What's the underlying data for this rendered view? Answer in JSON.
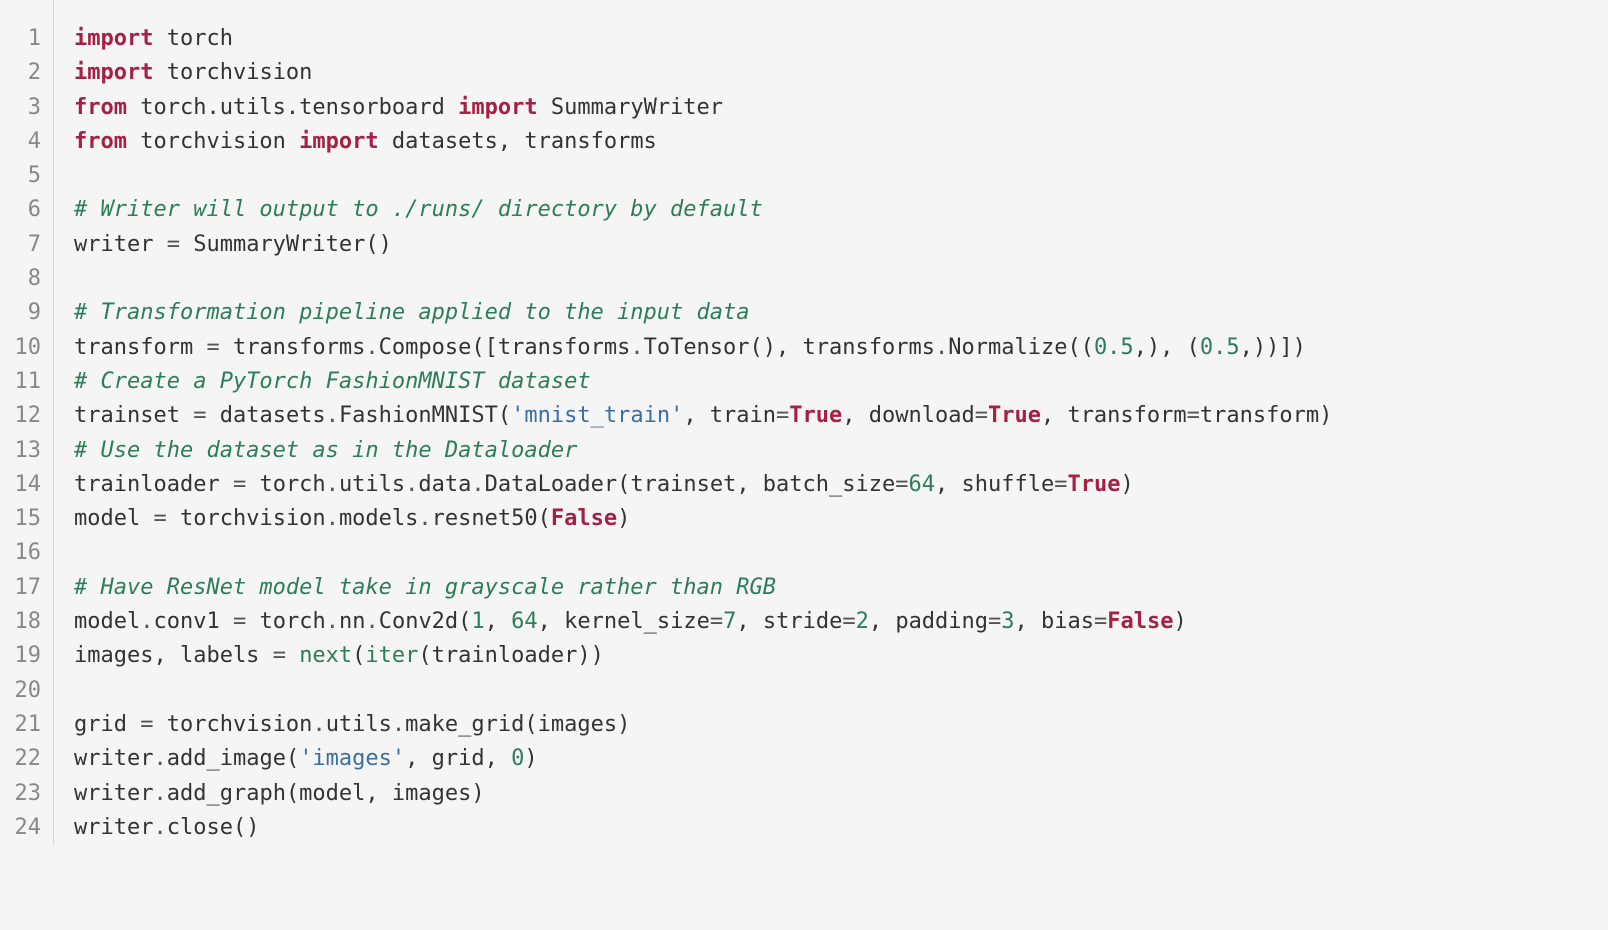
{
  "lines": [
    {
      "n": 1,
      "tokens": [
        {
          "t": "import",
          "c": "kw"
        },
        {
          "t": " torch"
        }
      ]
    },
    {
      "n": 2,
      "tokens": [
        {
          "t": "import",
          "c": "kw"
        },
        {
          "t": " torchvision"
        }
      ]
    },
    {
      "n": 3,
      "tokens": [
        {
          "t": "from",
          "c": "kw"
        },
        {
          "t": " torch.utils.tensorboard "
        },
        {
          "t": "import",
          "c": "kw"
        },
        {
          "t": " SummaryWriter"
        }
      ]
    },
    {
      "n": 4,
      "tokens": [
        {
          "t": "from",
          "c": "kw"
        },
        {
          "t": " torchvision "
        },
        {
          "t": "import",
          "c": "kw"
        },
        {
          "t": " datasets, transforms"
        }
      ]
    },
    {
      "n": 5,
      "tokens": []
    },
    {
      "n": 6,
      "tokens": [
        {
          "t": "# Writer will output to ./runs/ directory by default",
          "c": "cm"
        }
      ]
    },
    {
      "n": 7,
      "tokens": [
        {
          "t": "writer "
        },
        {
          "t": "=",
          "c": "op"
        },
        {
          "t": " SummaryWriter()"
        }
      ]
    },
    {
      "n": 8,
      "tokens": []
    },
    {
      "n": 9,
      "tokens": [
        {
          "t": "# Transformation pipeline applied to the input data",
          "c": "cm"
        }
      ]
    },
    {
      "n": 10,
      "tokens": [
        {
          "t": "transform "
        },
        {
          "t": "=",
          "c": "op"
        },
        {
          "t": " transforms"
        },
        {
          "t": ".",
          "c": "op"
        },
        {
          "t": "Compose([transforms"
        },
        {
          "t": ".",
          "c": "op"
        },
        {
          "t": "ToTensor(), transforms"
        },
        {
          "t": ".",
          "c": "op"
        },
        {
          "t": "Normalize(("
        },
        {
          "t": "0.5",
          "c": "nm"
        },
        {
          "t": ",), ("
        },
        {
          "t": "0.5",
          "c": "nm"
        },
        {
          "t": ",))])"
        }
      ]
    },
    {
      "n": 11,
      "tokens": [
        {
          "t": "# Create a PyTorch FashionMNIST dataset",
          "c": "cm"
        }
      ]
    },
    {
      "n": 12,
      "tokens": [
        {
          "t": "trainset "
        },
        {
          "t": "=",
          "c": "op"
        },
        {
          "t": " datasets"
        },
        {
          "t": ".",
          "c": "op"
        },
        {
          "t": "FashionMNIST("
        },
        {
          "t": "'mnist_train'",
          "c": "st"
        },
        {
          "t": ", train"
        },
        {
          "t": "=",
          "c": "op"
        },
        {
          "t": "True",
          "c": "bool"
        },
        {
          "t": ", download"
        },
        {
          "t": "=",
          "c": "op"
        },
        {
          "t": "True",
          "c": "bool"
        },
        {
          "t": ", transform"
        },
        {
          "t": "=",
          "c": "op"
        },
        {
          "t": "transform)"
        }
      ]
    },
    {
      "n": 13,
      "tokens": [
        {
          "t": "# Use the dataset as in the Dataloader",
          "c": "cm"
        }
      ]
    },
    {
      "n": 14,
      "tokens": [
        {
          "t": "trainloader "
        },
        {
          "t": "=",
          "c": "op"
        },
        {
          "t": " torch"
        },
        {
          "t": ".",
          "c": "op"
        },
        {
          "t": "utils"
        },
        {
          "t": ".",
          "c": "op"
        },
        {
          "t": "data"
        },
        {
          "t": ".",
          "c": "op"
        },
        {
          "t": "DataLoader(trainset, batch_size"
        },
        {
          "t": "=",
          "c": "op"
        },
        {
          "t": "64",
          "c": "nm"
        },
        {
          "t": ", shuffle"
        },
        {
          "t": "=",
          "c": "op"
        },
        {
          "t": "True",
          "c": "bool"
        },
        {
          "t": ")"
        }
      ]
    },
    {
      "n": 15,
      "tokens": [
        {
          "t": "model "
        },
        {
          "t": "=",
          "c": "op"
        },
        {
          "t": " torchvision"
        },
        {
          "t": ".",
          "c": "op"
        },
        {
          "t": "models"
        },
        {
          "t": ".",
          "c": "op"
        },
        {
          "t": "resnet50("
        },
        {
          "t": "False",
          "c": "bool"
        },
        {
          "t": ")"
        }
      ]
    },
    {
      "n": 16,
      "tokens": []
    },
    {
      "n": 17,
      "tokens": [
        {
          "t": "# Have ResNet model take in grayscale rather than RGB",
          "c": "cm"
        }
      ]
    },
    {
      "n": 18,
      "tokens": [
        {
          "t": "model"
        },
        {
          "t": ".",
          "c": "op"
        },
        {
          "t": "conv1 "
        },
        {
          "t": "=",
          "c": "op"
        },
        {
          "t": " torch"
        },
        {
          "t": ".",
          "c": "op"
        },
        {
          "t": "nn"
        },
        {
          "t": ".",
          "c": "op"
        },
        {
          "t": "Conv2d("
        },
        {
          "t": "1",
          "c": "nm"
        },
        {
          "t": ", "
        },
        {
          "t": "64",
          "c": "nm"
        },
        {
          "t": ", kernel_size"
        },
        {
          "t": "=",
          "c": "op"
        },
        {
          "t": "7",
          "c": "nm"
        },
        {
          "t": ", stride"
        },
        {
          "t": "=",
          "c": "op"
        },
        {
          "t": "2",
          "c": "nm"
        },
        {
          "t": ", padding"
        },
        {
          "t": "=",
          "c": "op"
        },
        {
          "t": "3",
          "c": "nm"
        },
        {
          "t": ", bias"
        },
        {
          "t": "=",
          "c": "op"
        },
        {
          "t": "False",
          "c": "bool"
        },
        {
          "t": ")"
        }
      ]
    },
    {
      "n": 19,
      "tokens": [
        {
          "t": "images, labels "
        },
        {
          "t": "=",
          "c": "op"
        },
        {
          "t": " "
        },
        {
          "t": "next",
          "c": "bi"
        },
        {
          "t": "("
        },
        {
          "t": "iter",
          "c": "bi"
        },
        {
          "t": "(trainloader))"
        }
      ]
    },
    {
      "n": 20,
      "tokens": []
    },
    {
      "n": 21,
      "tokens": [
        {
          "t": "grid "
        },
        {
          "t": "=",
          "c": "op"
        },
        {
          "t": " torchvision"
        },
        {
          "t": ".",
          "c": "op"
        },
        {
          "t": "utils"
        },
        {
          "t": ".",
          "c": "op"
        },
        {
          "t": "make_grid(images)"
        }
      ]
    },
    {
      "n": 22,
      "tokens": [
        {
          "t": "writer"
        },
        {
          "t": ".",
          "c": "op"
        },
        {
          "t": "add_image("
        },
        {
          "t": "'images'",
          "c": "st"
        },
        {
          "t": ", grid, "
        },
        {
          "t": "0",
          "c": "nm"
        },
        {
          "t": ")"
        }
      ]
    },
    {
      "n": 23,
      "tokens": [
        {
          "t": "writer"
        },
        {
          "t": ".",
          "c": "op"
        },
        {
          "t": "add_graph(model, images)"
        }
      ]
    },
    {
      "n": 24,
      "tokens": [
        {
          "t": "writer"
        },
        {
          "t": ".",
          "c": "op"
        },
        {
          "t": "close()"
        }
      ]
    }
  ]
}
